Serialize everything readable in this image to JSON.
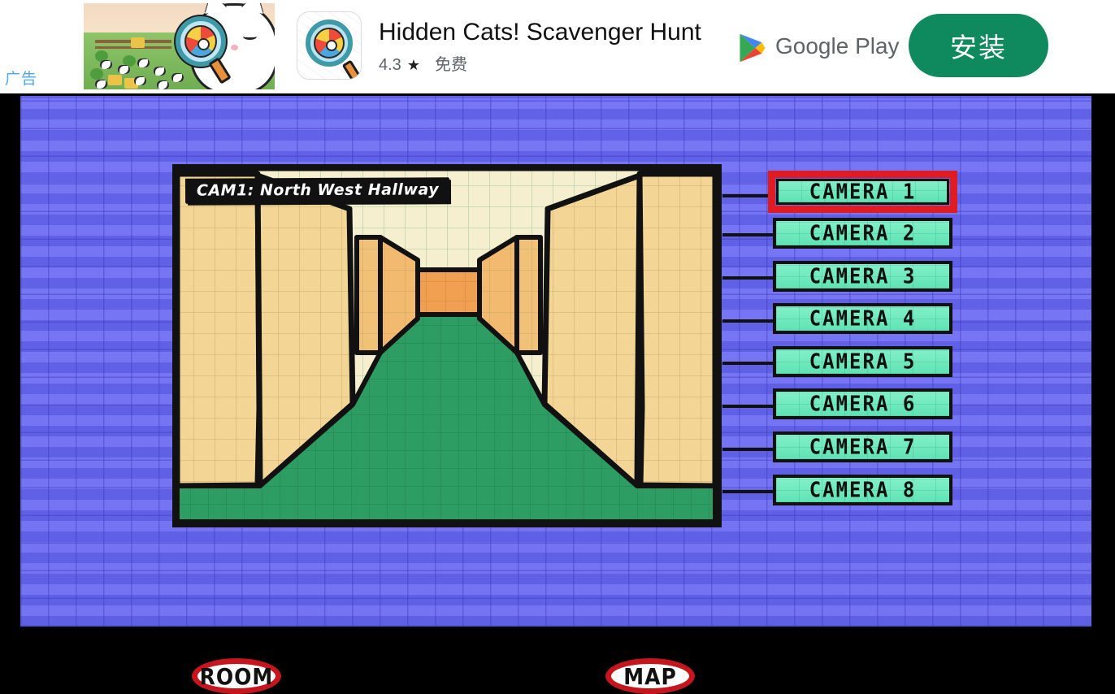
{
  "ad": {
    "label": "广告",
    "title": "Hidden Cats! Scavenger Hunt",
    "rating": "4.3",
    "star_icon": "★",
    "price": "免费",
    "store_name": "Google Play",
    "install_label": "安装",
    "brand_color": "#0f8a5f"
  },
  "game": {
    "viewport": {
      "camera_title": "CAM1: North West Hallway",
      "colors": {
        "wall": "#f3d595",
        "wall_shadow": "#f0c078",
        "floor": "#2d9d63",
        "ceiling": "#f6efcf",
        "back_wall": "#f0a050",
        "outline": "#111111",
        "background": "#6d6df4"
      }
    },
    "cameras": [
      {
        "label": "CAMERA 1",
        "selected": true
      },
      {
        "label": "CAMERA 2",
        "selected": false
      },
      {
        "label": "CAMERA 3",
        "selected": false
      },
      {
        "label": "CAMERA 4",
        "selected": false
      },
      {
        "label": "CAMERA 5",
        "selected": false
      },
      {
        "label": "CAMERA 6",
        "selected": false
      },
      {
        "label": "CAMERA 7",
        "selected": false
      },
      {
        "label": "CAMERA 8",
        "selected": false
      }
    ],
    "selected_color": "#e01b22",
    "button_color": "#6fe9be",
    "nav": {
      "room_label": "ROOM",
      "map_label": "MAP"
    }
  }
}
